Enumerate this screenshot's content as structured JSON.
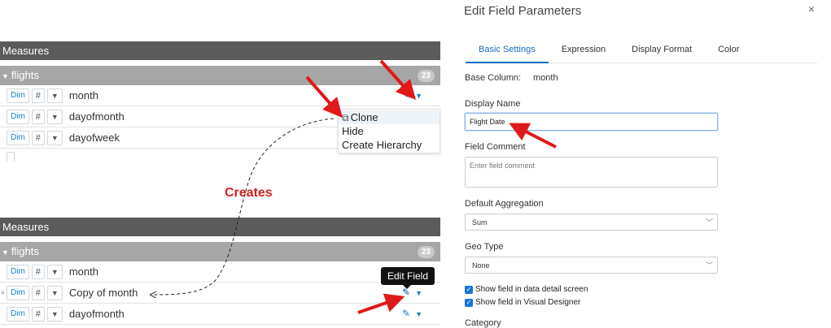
{
  "top_panel": {
    "header": "Measures",
    "group": {
      "name": "flights",
      "count": "23"
    },
    "rows": [
      {
        "dim": "Dim",
        "type": "#",
        "name": "month"
      },
      {
        "dim": "Dim",
        "type": "#",
        "name": "dayofmonth"
      },
      {
        "dim": "Dim",
        "type": "#",
        "name": "dayofweek"
      }
    ],
    "context_menu": [
      "Clone",
      "Hide",
      "Create Hierarchy"
    ]
  },
  "annotation": {
    "creates": "Creates"
  },
  "bottom_panel": {
    "header": "Measures",
    "group": {
      "name": "flights",
      "count": "23"
    },
    "rows": [
      {
        "dim": "Dim",
        "type": "#",
        "name": "month"
      },
      {
        "dim": "Dim",
        "type": "#",
        "name": "Copy of month"
      },
      {
        "dim": "Dim",
        "type": "#",
        "name": "dayofmonth"
      }
    ],
    "tooltip": "Edit Field"
  },
  "dialog": {
    "title": "Edit Field Parameters",
    "close": "×",
    "tabs": [
      "Basic Settings",
      "Expression",
      "Display Format",
      "Color"
    ],
    "base_column_label": "Base Column:",
    "base_column_value": "month",
    "display_name_label": "Display Name",
    "display_name_value": "Flight Date",
    "field_comment_label": "Field Comment",
    "field_comment_placeholder": "Enter field comment",
    "default_aggregation_label": "Default Aggregation",
    "default_aggregation_value": "Sum",
    "geo_type_label": "Geo Type",
    "geo_type_value": "None",
    "checkboxes": [
      "Show field in data detail screen",
      "Show field in Visual Designer"
    ],
    "category_label": "Category"
  },
  "colors": {
    "arrow": "#e0191b",
    "accent": "#1a6bbf",
    "header": "#5b5b5b",
    "group": "#a6a6a6"
  }
}
